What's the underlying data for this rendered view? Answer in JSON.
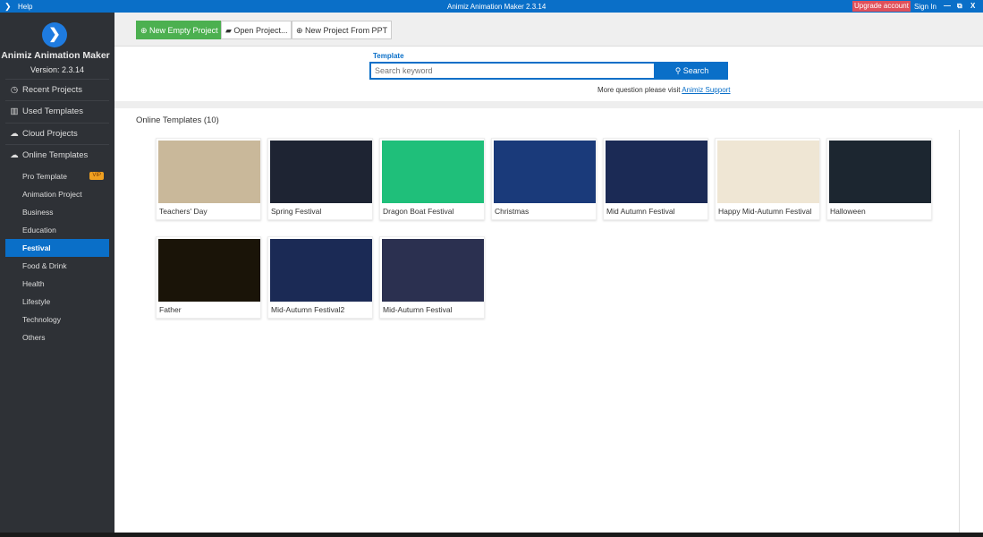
{
  "titlebar": {
    "menu_help": "Help",
    "title": "Animiz Animation Maker 2.3.14",
    "upgrade": "Upgrade account",
    "sign_in": "Sign In",
    "minimize": "—",
    "restore": "⧉",
    "close": "X"
  },
  "sidebar": {
    "app_name": "Animiz Animation Maker",
    "version": "Version: 2.3.14",
    "nav": [
      {
        "label": "Recent Projects",
        "icon": "clock-icon"
      },
      {
        "label": "Used Templates",
        "icon": "template-icon"
      },
      {
        "label": "Cloud Projects",
        "icon": "cloud-icon"
      },
      {
        "label": "Online Templates",
        "icon": "cloud-icon"
      }
    ],
    "categories": [
      {
        "label": "Pro Template",
        "badge": "VIP"
      },
      {
        "label": "Animation Project"
      },
      {
        "label": "Business"
      },
      {
        "label": "Education"
      },
      {
        "label": "Festival",
        "active": true
      },
      {
        "label": "Food & Drink"
      },
      {
        "label": "Health"
      },
      {
        "label": "Lifestyle"
      },
      {
        "label": "Technology"
      },
      {
        "label": "Others"
      }
    ]
  },
  "toolbar": {
    "new_empty": "New Empty Project",
    "open": "Open Project...",
    "new_ppt": "New Project From PPT"
  },
  "search": {
    "label": "Template",
    "placeholder": "Search keyword",
    "button": "Search",
    "support_text": "More question please visit",
    "support_link": "Animiz Support"
  },
  "templates": {
    "title": "Online Templates (10)",
    "items": [
      {
        "label": "Teachers' Day",
        "color": "#c9b89a"
      },
      {
        "label": "Spring Festival",
        "color": "#1e2433"
      },
      {
        "label": "Dragon Boat Festival",
        "color": "#1fbf7a"
      },
      {
        "label": "Christmas",
        "color": "#1a3a7a"
      },
      {
        "label": "Mid Autumn Festival",
        "color": "#1b2a55"
      },
      {
        "label": "Happy Mid-Autumn Festival",
        "color": "#efe6d4"
      },
      {
        "label": "Halloween",
        "color": "#1c2630"
      },
      {
        "label": "Father",
        "color": "#1a1408"
      },
      {
        "label": "Mid-Autumn Festival2",
        "color": "#1b2a55"
      },
      {
        "label": "Mid-Autumn Festival",
        "color": "#2b3050"
      }
    ]
  },
  "colors": {
    "accent": "#0a6fc8",
    "green": "#4cb050",
    "upgrade": "#e0505a",
    "sidebar": "#2e3136"
  }
}
